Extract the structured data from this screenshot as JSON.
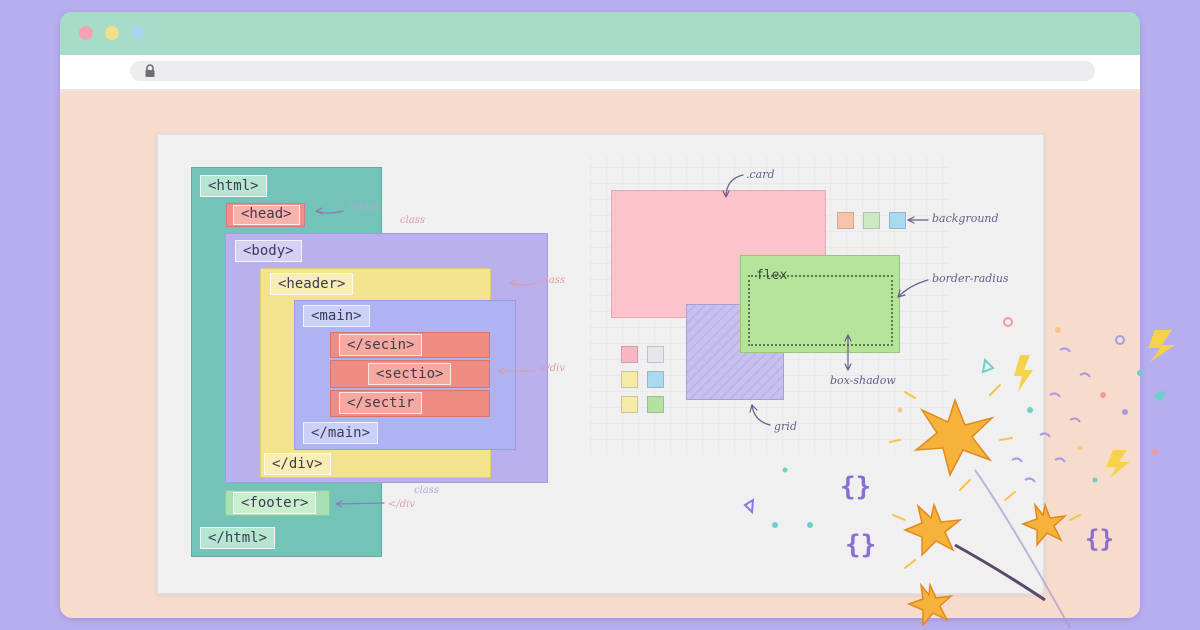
{
  "window": {
    "traffic_lights": [
      "#f4a3b4",
      "#f3df8a",
      "#a9d6ef"
    ],
    "titlebar_color": "#a7dcc9",
    "content_color": "#f8dccb",
    "address_icon": "lock-icon"
  },
  "dom_tree": {
    "html_open": "<html>",
    "head": "<head>",
    "body": "<body>",
    "header": "<header>",
    "main_open": "<main>",
    "section_1": "</secin>",
    "section_2": "<sectio>",
    "section_3": "</sectir",
    "main_close": "</main>",
    "div_close": "</div>",
    "footer": "<footer>",
    "html_close": "</html>"
  },
  "dom_notes": {
    "head_note_1": "</clas",
    "head_note_2": "class",
    "header_note": "class",
    "section_note": "</div",
    "footer_note_1": "class",
    "footer_note_2": "</div"
  },
  "css_notes": {
    "card": ".card",
    "flex": "flex",
    "background": "background",
    "border_radius": "border-radius",
    "box_shadow": "box-shadow",
    "grid": "grid"
  },
  "colors": {
    "html_box": "#74c3b9",
    "head_tag": "#ef8f87",
    "body_box": "#bab0ee",
    "header_box": "#f4e38e",
    "main_box": "#aeb4f3",
    "section_box": "#ef8d83",
    "footer_tag": "#a7e0b5",
    "card": "#fbc4cc",
    "flex_box": "#b6e39a",
    "grid_box": "#c8c0ee",
    "swatches_top": [
      "#f6c4a6",
      "#cfe8c4",
      "#a9d9ef"
    ],
    "swatches_grid": [
      "#f7b8c3",
      "#e6e6ea",
      "#f5eaa6",
      "#a9d9ef",
      "#f5eaa6",
      "#b4e1a0"
    ]
  },
  "decorations": {
    "icons": [
      "sparkler-star-icon",
      "curly-brace-icon",
      "lightning-icon",
      "confetti-icon"
    ]
  }
}
